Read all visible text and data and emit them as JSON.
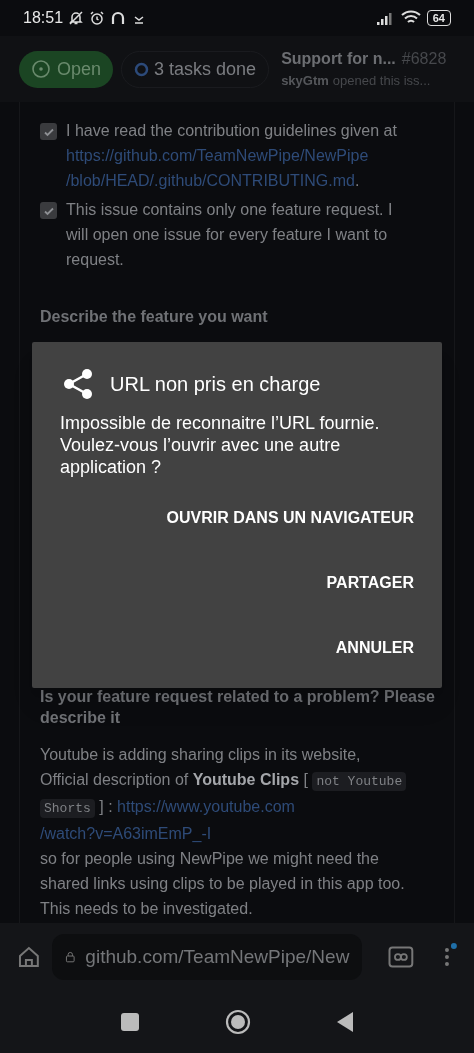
{
  "status_bar": {
    "time": "18:51",
    "battery": "64"
  },
  "header": {
    "state": "Open",
    "tasks": "3 tasks done",
    "title": "Support for n...",
    "number": "#6828",
    "author": "skyGtm",
    "subtitle": "opened this iss..."
  },
  "checklist": [
    {
      "text": "I have read the contribution guidelines given at ",
      "link": [
        "https://github.com/TeamNewPipe/NewPipe",
        "/blob/HEAD/.github/CONTRIBUTING.md"
      ],
      "suffix": ".",
      "checked": true
    },
    {
      "text": "This issue contains only one feature request. I will open one issue for every feature I want to request.",
      "checked": true
    }
  ],
  "sections": [
    {
      "heading": "Describe the feature you want"
    },
    {
      "heading": "Is your feature request related to a problem? Please describe it",
      "segments": [
        {
          "kind": "text",
          "text": "Youtube is adding sharing clips in its website,"
        },
        {
          "kind": "break"
        },
        {
          "kind": "text",
          "text": "Official description of "
        },
        {
          "kind": "bold",
          "text": "Youtube Clips"
        },
        {
          "kind": "text",
          "text": " [ "
        },
        {
          "kind": "code",
          "text": "not Youtube"
        },
        {
          "kind": "break"
        },
        {
          "kind": "code",
          "text": "Shorts"
        },
        {
          "kind": "text",
          "text": " ] : "
        },
        {
          "kind": "link",
          "text": "https://www.youtube.com"
        },
        {
          "kind": "break"
        },
        {
          "kind": "link",
          "text": "/watch?v=A63imEmP_-I"
        },
        {
          "kind": "break"
        },
        {
          "kind": "text",
          "text": "so for people using NewPipe we might need the shared links using clips to be played in this app too. This needs to be investigated."
        }
      ]
    }
  ],
  "dialog": {
    "title": "URL non pris en charge",
    "message": "Impossible de reconnaitre l’URL fournie. Voulez-vous l’ouvrir avec une autre application ?",
    "actions": [
      "OUVRIR DANS UN NAVIGATEUR",
      "PARTAGER",
      "ANNULER"
    ]
  },
  "browser_bar": {
    "url": "github.com/TeamNewPipe/New"
  }
}
